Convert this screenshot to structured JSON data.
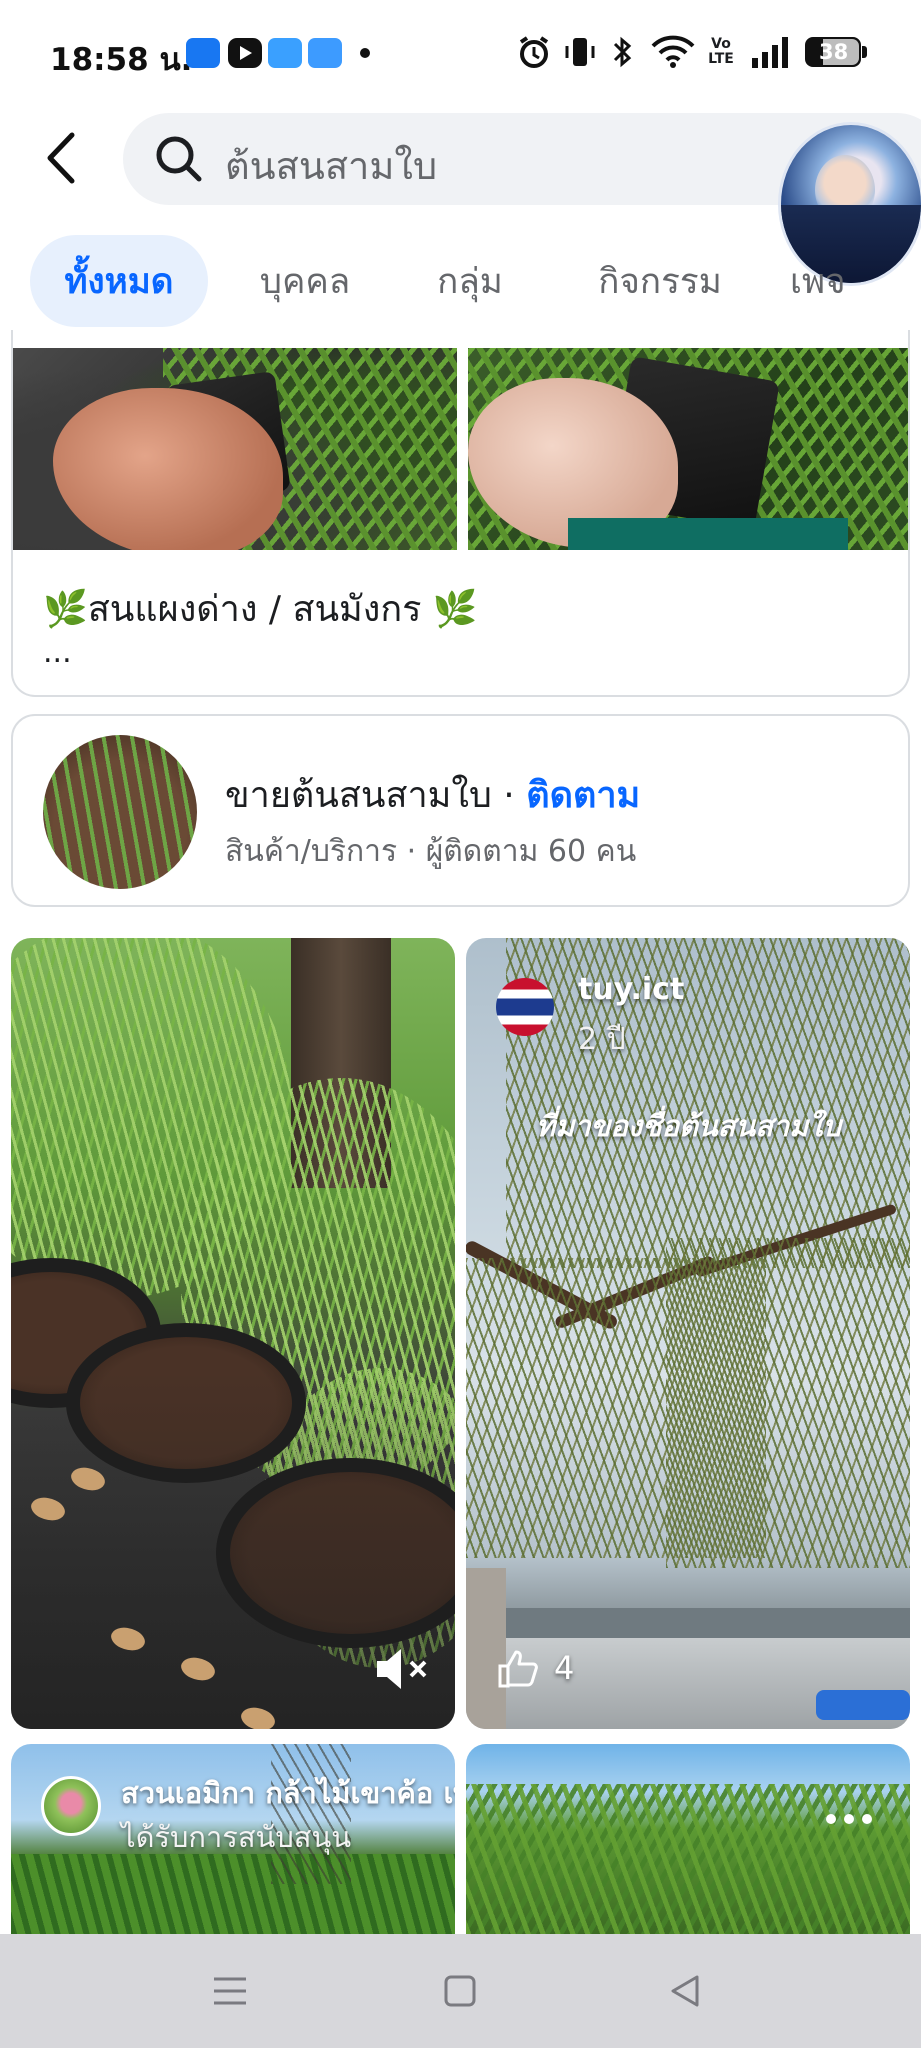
{
  "status_bar": {
    "time": "18:58 น.",
    "battery": "38",
    "network": "Vo LTE",
    "app_colors": [
      "#1877f2",
      "#ff0000",
      "#3aa0ff",
      "#3d9bff"
    ]
  },
  "search": {
    "query": "ต้นสนสามใบ",
    "back_icon": "chevron-left-icon",
    "search_icon": "magnifier-icon"
  },
  "tabs": [
    {
      "label": "ทั้งหมด",
      "active": true
    },
    {
      "label": "บุคคล",
      "active": false
    },
    {
      "label": "กลุ่ม",
      "active": false
    },
    {
      "label": "กิจกรรม",
      "active": false
    },
    {
      "label": "เพจ",
      "active": false
    }
  ],
  "post_card": {
    "title": "🌿สนแผงด่าง / สนมังกร 🌿",
    "more": "..."
  },
  "page_card": {
    "name": "ขายต้นสนสามใบ",
    "separator": " · ",
    "follow_label": "ติดตาม",
    "subtitle": "สินค้า/บริการ · ผู้ติดตาม 60 คน"
  },
  "reels": [
    {
      "muted_icon": "speaker-muted-icon"
    },
    {
      "author": "tuy.ict",
      "age": "2 ปี",
      "caption": "ที่มาของชื่อต้นสนสามใบ",
      "likes": "4"
    }
  ],
  "bottom_posts": [
    {
      "author": "สวนเอมิกา กล้าไม้เขาค้อ เพชรบูรณ์",
      "tag": "ได้รับการสนับสนุน"
    },
    {
      "more_icon": "more-dots-icon"
    }
  ],
  "colors": {
    "accent": "#0866ff",
    "tab_active_bg": "#e7f0fd",
    "muted_text": "#65676b"
  }
}
